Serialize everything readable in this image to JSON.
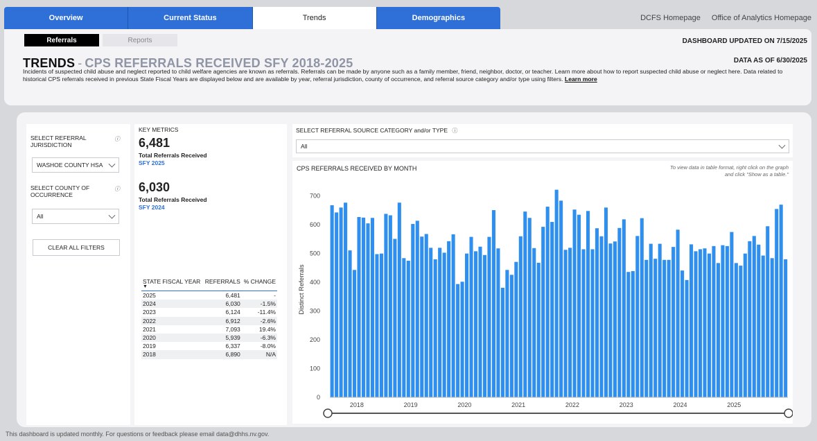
{
  "nav": {
    "tabs": [
      "Overview",
      "Current Status",
      "Trends",
      "Demographics"
    ],
    "active_index": 2,
    "links": [
      "DCFS Homepage",
      "Office of Analytics Homepage"
    ]
  },
  "subtabs": [
    "Referrals",
    "Reports"
  ],
  "header": {
    "updated": "DASHBOARD UPDATED ON  7/15/2025",
    "data_as_of": "DATA AS OF 6/30/2025",
    "title_main": "TRENDS",
    "title_sep": "-",
    "title_sub": "CPS REFERRALS RECEIVED SFY 2018-2025",
    "description": "Incidents of suspected child abuse and neglect reported to child welfare agencies are known as referrals. Referrals can be made by anyone such as a family member, friend, neighbor, doctor, or teacher.  Learn more about how to report suspected child abuse or neglect here. Data related to historical CPS referrals received in previous State Fiscal Years are displayed below and are available by year, referral jurisdiction, county of occurrence, and referral source category and/or type using filters.",
    "learn_more": "Learn more"
  },
  "filters": {
    "jurisdiction_label": "SELECT REFERRAL JURISDICTION",
    "jurisdiction_value": "WASHOE COUNTY HSA",
    "county_label": "SELECT COUNTY OF OCCURRENCE",
    "county_value": "All",
    "clear_label": "CLEAR ALL FILTERS",
    "info_icon": "ⓘ"
  },
  "metrics": {
    "label": "KEY METRICS",
    "kpi1": {
      "value": "6,481",
      "label": "Total Referrals Received",
      "sfy": "SFY 2025"
    },
    "kpi2": {
      "value": "6,030",
      "label": "Total Referrals Received",
      "sfy": "SFY 2024"
    },
    "table": {
      "headers": [
        "STATE FISCAL YEAR",
        "REFERRALS",
        "% CHANGE"
      ],
      "rows": [
        [
          "2025",
          "6,481",
          "-"
        ],
        [
          "2024",
          "6,030",
          "-1.5%"
        ],
        [
          "2023",
          "6,124",
          "-11.4%"
        ],
        [
          "2022",
          "6,912",
          "-2.6%"
        ],
        [
          "2021",
          "7,093",
          "19.4%"
        ],
        [
          "2020",
          "5,939",
          "-6.3%"
        ],
        [
          "2019",
          "6,337",
          "-8.0%"
        ],
        [
          "2018",
          "6,890",
          "N/A"
        ]
      ]
    }
  },
  "source": {
    "label": "SELECT REFERRAL SOURCE CATEGORY and/or TYPE",
    "value": "All"
  },
  "chart_hint": [
    "To view data in table format, right click on the graph",
    "and click \"Show as a table.\""
  ],
  "chart_data": {
    "type": "bar",
    "title": "CPS REFERRALS RECEIVED BY MONTH",
    "ylabel": "Distinct Referrals",
    "xlabel": "",
    "ylim": [
      0,
      750
    ],
    "yticks": [
      0,
      100,
      200,
      300,
      400,
      500,
      600,
      700
    ],
    "xtick_labels": [
      "2018",
      "2019",
      "2020",
      "2021",
      "2022",
      "2023",
      "2024",
      "2025"
    ],
    "color": "#2e8fee",
    "values": [
      668,
      643,
      660,
      677,
      511,
      443,
      627,
      625,
      605,
      624,
      498,
      500,
      638,
      633,
      551,
      677,
      484,
      475,
      603,
      614,
      559,
      568,
      520,
      480,
      520,
      503,
      543,
      567,
      394,
      402,
      500,
      558,
      508,
      524,
      495,
      558,
      651,
      518,
      381,
      443,
      426,
      471,
      560,
      646,
      624,
      519,
      468,
      593,
      663,
      610,
      722,
      684,
      513,
      520,
      653,
      635,
      515,
      648,
      515,
      588,
      560,
      660,
      535,
      542,
      589,
      619,
      436,
      439,
      561,
      623,
      478,
      534,
      482,
      534,
      478,
      478,
      523,
      583,
      441,
      408,
      532,
      508,
      515,
      518,
      500,
      526,
      467,
      529,
      526,
      575,
      467,
      458,
      500,
      543,
      561,
      531,
      493,
      595,
      484,
      655,
      670,
      480
    ]
  },
  "footer": "This dashboard is updated monthly. For questions or feedback please email data@dhhs.nv.gov."
}
